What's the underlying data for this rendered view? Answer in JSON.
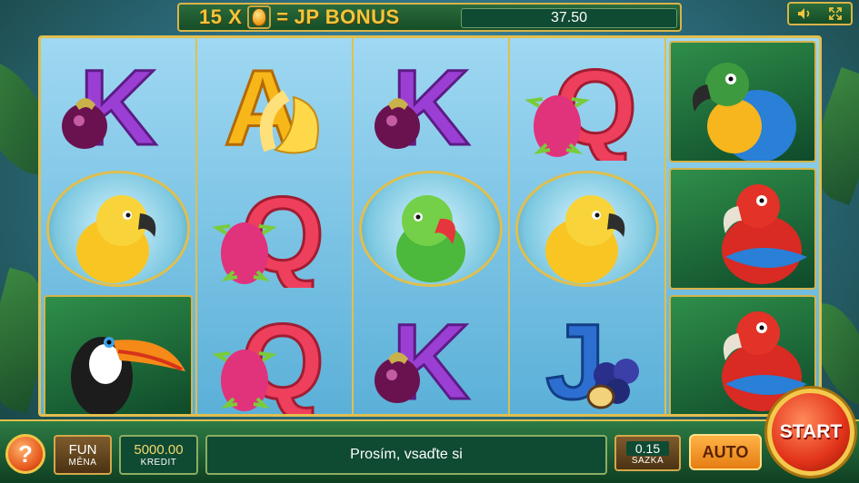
{
  "jackpot": {
    "multiplier": "15 X",
    "equals": "=",
    "label": "JP BONUS",
    "value": "37.50"
  },
  "top_controls": {
    "sound_icon": "speaker-icon",
    "fullscreen_icon": "fullscreen-icon"
  },
  "reels": [
    {
      "symbols": [
        "K-mangosteen",
        "yellow-parrot",
        "toucan"
      ]
    },
    {
      "symbols": [
        "A-banana",
        "Q-dragonfruit",
        "Q-dragonfruit"
      ]
    },
    {
      "symbols": [
        "K-mangosteen",
        "green-parrot",
        "K-mangosteen"
      ]
    },
    {
      "symbols": [
        "Q-dragonfruit",
        "yellow-parrot",
        "J-berries"
      ]
    },
    {
      "symbols": [
        "blue-macaw",
        "red-macaw",
        "red-macaw"
      ]
    }
  ],
  "colors": {
    "K": "#9b3fd4",
    "A": "#f7b719",
    "Q": "#ee3f5d",
    "J": "#2d6fd0",
    "frame": "#e0bf4e"
  },
  "bottom": {
    "help_label": "?",
    "fun_label": "FUN",
    "currency_label": "MĚNA",
    "credit_value": "5000.00",
    "credit_label": "KREDIT",
    "message": "Prosím, vsaďte si",
    "bet_value": "0.15",
    "bet_label": "SAZKA",
    "auto_label": "AUTO",
    "start_label": "START"
  }
}
